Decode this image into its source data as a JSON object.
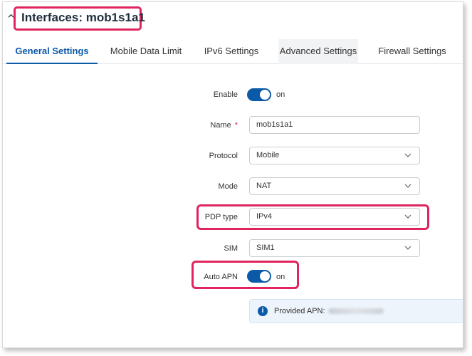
{
  "header": {
    "title": "Interfaces: mob1s1a1"
  },
  "tabs": [
    {
      "label": "General Settings"
    },
    {
      "label": "Mobile Data Limit"
    },
    {
      "label": "IPv6 Settings"
    },
    {
      "label": "Advanced Settings"
    },
    {
      "label": "Firewall Settings"
    }
  ],
  "form": {
    "enable": {
      "label": "Enable",
      "state": "on"
    },
    "name": {
      "label": "Name",
      "required_mark": "*",
      "value": "mob1s1a1"
    },
    "protocol": {
      "label": "Protocol",
      "value": "Mobile"
    },
    "mode": {
      "label": "Mode",
      "value": "NAT"
    },
    "pdp_type": {
      "label": "PDP type",
      "value": "IPv4"
    },
    "sim": {
      "label": "SIM",
      "value": "SIM1"
    },
    "auto_apn": {
      "label": "Auto APN",
      "state": "on"
    }
  },
  "info": {
    "icon": "info-icon",
    "glyph": "i",
    "text": "Provided APN:"
  },
  "colors": {
    "accent": "#0b5aa8",
    "highlight": "#e0245e"
  }
}
